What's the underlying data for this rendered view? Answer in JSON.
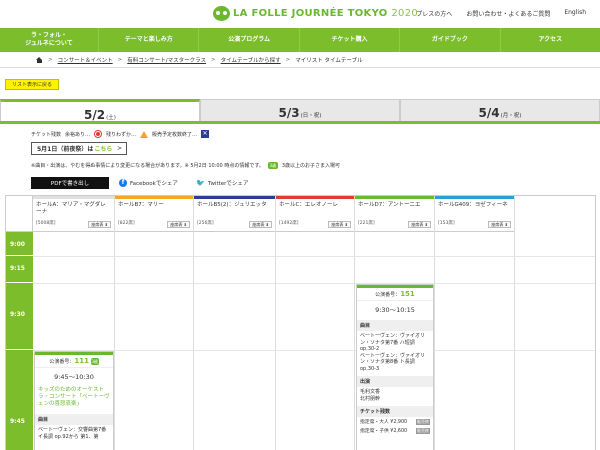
{
  "header": {
    "logo_text": "LA FOLLE JOURNÉE TOKYO",
    "logo_year": "2020",
    "links": [
      "プレスの方へ",
      "お問い合わせ・よくあるご質問",
      "English"
    ]
  },
  "nav": [
    "ラ・フォル・\nジュルネについて",
    "テーマと楽しみ方",
    "公演プログラム",
    "チケット購入",
    "ガイドブック",
    "アクセス"
  ],
  "breadcrumb": [
    "コンサート＆イベント",
    "有料コンサート/マスタークラス",
    "タイムテーブルから探す",
    "マイリスト タイムテーブル"
  ],
  "back_button": "リスト表示に戻る",
  "day_tabs": [
    {
      "date": "5/2",
      "suffix": "(土)",
      "active": true
    },
    {
      "date": "5/3",
      "suffix": "(日・祝)",
      "active": false
    },
    {
      "date": "5/4",
      "suffix": "(月・祝)",
      "active": false
    }
  ],
  "legend": {
    "label": "チケット残数",
    "items": [
      "余裕あり…",
      "残りわずか…",
      "販売予定枚数終了…"
    ],
    "x_mark": "✕"
  },
  "may1": {
    "text": "5月1日（前夜祭）は",
    "link": "こちら",
    "chevron": ">"
  },
  "note": {
    "text": "※曲目・出演は、やむを得ぬ事情により変更になる場合があります。※ 5月2日 10:00 時点の情報です。",
    "kid_icon": "3歳",
    "kid_text": "3歳以上のお子さま入場可"
  },
  "pdf_button": "PDFで書き出し",
  "share": {
    "facebook": "Facebookでシェア",
    "twitter": "Twitterでシェア",
    "fb_glyph": "f",
    "tw_glyph": "🐦"
  },
  "seat_label": "座席表 ⬇",
  "times": [
    "9:00",
    "9:15",
    "9:30",
    "9:45"
  ],
  "halls": [
    {
      "name": "ホールA：マリア・マグダレーナ",
      "cap": "[5008席]",
      "color": "#e0e0e0"
    },
    {
      "name": "ホールB7：マリー",
      "cap": "[822席]",
      "color": "#f5a623"
    },
    {
      "name": "ホールB5(2)：ジュリエッタ",
      "cap": "[256席]",
      "color": "#2c3e8f"
    },
    {
      "name": "ホールC：エレオノーレ",
      "cap": "[1492席]",
      "color": "#e53935"
    },
    {
      "name": "ホールD7：アントーニエ",
      "cap": "[221席]",
      "color": "#6ab82e"
    },
    {
      "name": "ホールG409：ヨゼフィーネ",
      "cap": "[153席]",
      "color": "#2a9fd6"
    }
  ],
  "events": [
    {
      "hall_index": 0,
      "number_label": "公演番号：",
      "number": "111",
      "time": "9:45〜10:30",
      "title": "キッズのためのオーケストラ・コンサート「ベートーヴェンの喜怒哀楽」",
      "sections": [
        {
          "label": "曲目",
          "body": "ベートーヴェン：交響曲第7番 イ長調 op.92から 第1、第"
        }
      ],
      "prices": []
    },
    {
      "hall_index": 4,
      "number_label": "公演番号：",
      "number": "151",
      "time": "9:30〜10:15",
      "title": "",
      "sections": [
        {
          "label": "曲目",
          "body": "ベートーヴェン：ヴァイオリン・ソナタ第7番 ハ短調 op.30-2\nベートーヴェン：ヴァイオリン・ソナタ第8番 ト長調 op.30-3"
        },
        {
          "label": "出演",
          "body": "毛利文香\n北村朋幹"
        },
        {
          "label": "チケット残数",
          "body": ""
        }
      ],
      "prices": [
        {
          "label": "指定席・大人 ¥2,900",
          "status": "販売終"
        },
        {
          "label": "指定席・子供 ¥2,600",
          "status": "販売終"
        }
      ]
    }
  ]
}
